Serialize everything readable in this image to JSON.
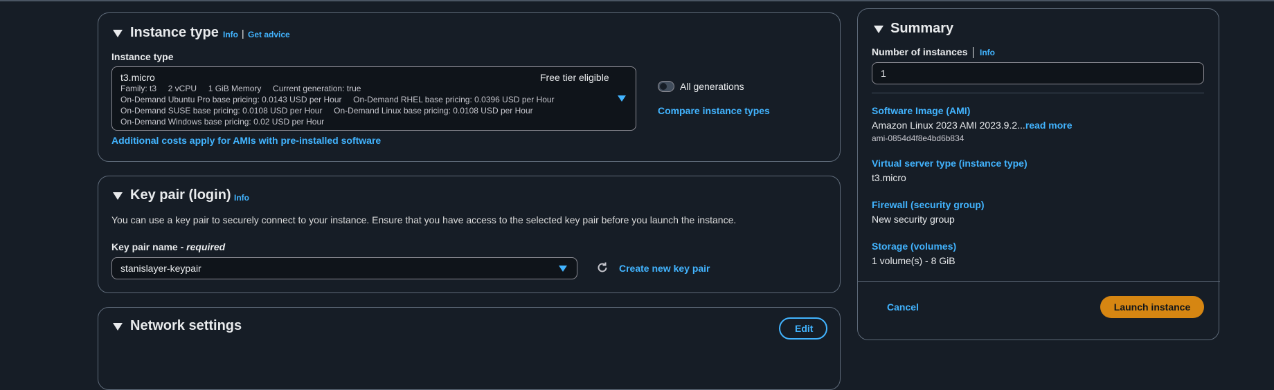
{
  "instance_type": {
    "title": "Instance type",
    "info": "Info",
    "divider": "|",
    "get_advice": "Get advice",
    "field_label": "Instance type",
    "selected": {
      "name": "t3.micro",
      "free_tier": "Free tier eligible",
      "details_line1": "Family: t3     2 vCPU     1 GiB Memory     Current generation: true",
      "details_line2": "On-Demand Ubuntu Pro base pricing: 0.0143 USD per Hour     On-Demand RHEL base pricing: 0.0396 USD per Hour",
      "details_line3": "On-Demand SUSE base pricing: 0.0108 USD per Hour     On-Demand Linux base pricing: 0.0108 USD per Hour",
      "details_line4": "On-Demand Windows base pricing: 0.02 USD per Hour"
    },
    "all_generations": "All generations",
    "compare": "Compare instance types",
    "additional_costs": "Additional costs apply for AMIs with pre-installed software"
  },
  "key_pair": {
    "title": "Key pair (login)",
    "info": "Info",
    "description": "You can use a key pair to securely connect to your instance. Ensure that you have access to the selected key pair before you launch the instance.",
    "name_label": "Key pair name - ",
    "required": "required",
    "selected": "stanislayer-keypair",
    "create_new": "Create new key pair"
  },
  "network": {
    "title": "Network settings",
    "edit": "Edit"
  },
  "summary": {
    "title": "Summary",
    "num_instances_label": "Number of instances",
    "info": "Info",
    "num_instances_value": "1",
    "ami_label": "Software Image (AMI)",
    "ami_value": "Amazon Linux 2023 AMI 2023.9.2...",
    "read_more": "read more",
    "ami_id": "ami-0854d4f8e4bd6b834",
    "vs_type_label": "Virtual server type (instance type)",
    "vs_type_value": "t3.micro",
    "firewall_label": "Firewall (security group)",
    "firewall_value": "New security group",
    "storage_label": "Storage (volumes)",
    "storage_value": "1 volume(s) - 8 GiB",
    "cancel": "Cancel",
    "launch": "Launch instance"
  },
  "colors": {
    "background": "#161d26",
    "link": "#42b4ff",
    "primary_button": "#d68612",
    "border": "#5f6b7a"
  }
}
